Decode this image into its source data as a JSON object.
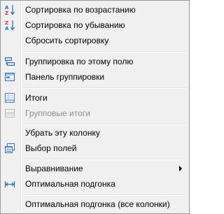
{
  "menu": {
    "sort_asc": {
      "label": "Сортировка по возрастанию",
      "icon": "sort-ascending-icon"
    },
    "sort_desc": {
      "label": "Сортировка по убыванию",
      "icon": "sort-descending-icon"
    },
    "reset_sort": {
      "label": "Сбросить сортировку"
    },
    "group_by_field": {
      "label": "Группировка по этому полю",
      "icon": "group-by-field-icon"
    },
    "group_panel": {
      "label": "Панель группировки",
      "icon": "group-panel-icon"
    },
    "totals": {
      "label": "Итоги",
      "icon": "totals-grid-icon"
    },
    "group_totals": {
      "label": "Групповые итоги",
      "icon": "group-totals-icon",
      "disabled": true
    },
    "remove_column": {
      "label": "Убрать эту колонку"
    },
    "field_chooser": {
      "label": "Выбор полей",
      "icon": "field-chooser-icon"
    },
    "alignment": {
      "label": "Выравнивание",
      "has_submenu": true
    },
    "best_fit": {
      "label": "Оптимальная подгонка",
      "icon": "best-fit-icon"
    },
    "best_fit_all": {
      "label": "Оптимальная подгонка (все колонки)"
    }
  },
  "colors": {
    "menu_background": "#f0f0f0",
    "border": "#979797",
    "disabled_text": "#8d8d8d",
    "icon_blue": "#2a6ab8",
    "icon_red": "#d03030"
  }
}
